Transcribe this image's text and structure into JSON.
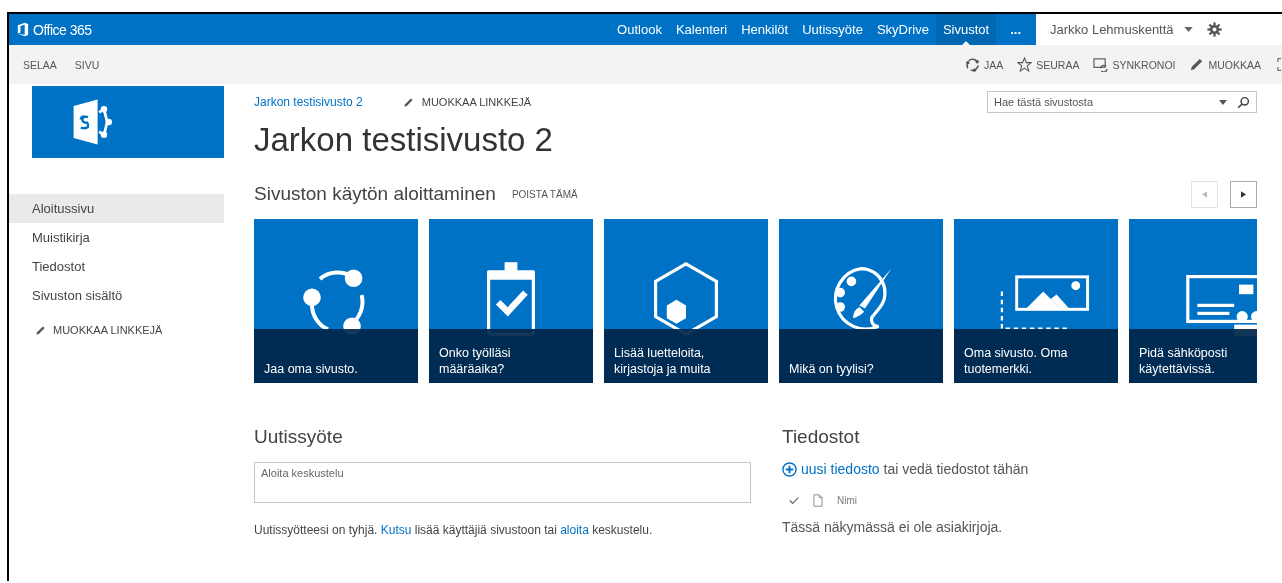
{
  "suite_bar": {
    "brand": "Office 365",
    "nav": [
      {
        "label": "Outlook",
        "selected": false
      },
      {
        "label": "Kalenteri",
        "selected": false
      },
      {
        "label": "Henkilöt",
        "selected": false
      },
      {
        "label": "Uutissyöte",
        "selected": false
      },
      {
        "label": "SkyDrive",
        "selected": false
      },
      {
        "label": "Sivustot",
        "selected": true
      },
      {
        "label": "...",
        "selected": false
      }
    ],
    "user": "Jarkko Lehmuskenttä"
  },
  "ribbon": {
    "tabs": [
      "SELAA",
      "SIVU"
    ],
    "actions": [
      {
        "label": "JAA",
        "kind": "share"
      },
      {
        "label": "SEURAA",
        "kind": "follow"
      },
      {
        "label": "SYNKRONOI",
        "kind": "sync"
      },
      {
        "label": "MUOKKAA",
        "kind": "edit"
      }
    ]
  },
  "site": {
    "breadcrumb": "Jarkon testisivusto 2",
    "edit_links": "MUOKKAA LINKKEJÄ",
    "title": "Jarkon testisivusto 2",
    "search_placeholder": "Hae tästä sivustosta"
  },
  "quick_launch": {
    "items": [
      {
        "label": "Aloitussivu",
        "selected": true
      },
      {
        "label": "Muistikirja",
        "selected": false
      },
      {
        "label": "Tiedostot",
        "selected": false
      },
      {
        "label": "Sivuston sisältö",
        "selected": false
      }
    ],
    "edit_links": "MUOKKAA LINKKEJÄ"
  },
  "getting_started": {
    "title": "Sivuston käytön aloittaminen",
    "dismiss": "POISTA TÄMÄ",
    "pager": [
      {
        "kind": "prev",
        "disabled": true
      },
      {
        "kind": "next",
        "disabled": false
      }
    ],
    "tiles": [
      {
        "kind": "share",
        "caption": [
          "Jaa oma sivusto."
        ]
      },
      {
        "kind": "task",
        "caption": [
          "Onko työlläsi",
          "määräaika?"
        ]
      },
      {
        "kind": "apps",
        "caption": [
          "Lisää luetteloita,",
          "kirjastoja ja muita"
        ]
      },
      {
        "kind": "style",
        "caption": [
          "Mikä on tyylisi?"
        ]
      },
      {
        "kind": "brand",
        "caption": [
          "Oma sivusto. Oma",
          "tuotemerkki."
        ]
      },
      {
        "kind": "mail",
        "caption": [
          "Pidä sähköposti",
          "käytettävissä."
        ]
      }
    ]
  },
  "newsfeed": {
    "title": "Uutissyöte",
    "placeholder": "Aloita keskustelu",
    "message": [
      {
        "kind": "text",
        "text": "Uutissyötteesi on tyhjä. "
      },
      {
        "kind": "link",
        "text": "Kutsu"
      },
      {
        "kind": "text",
        "text": " lisää käyttäjiä sivustoon tai "
      },
      {
        "kind": "link",
        "text": "aloita"
      },
      {
        "kind": "text",
        "text": " keskustelu."
      }
    ]
  },
  "documents": {
    "title": "Tiedostot",
    "upload": [
      {
        "kind": "link",
        "text": "uusi tiedosto"
      },
      {
        "kind": "text",
        "text": " tai vedä tiedostot tähän"
      }
    ],
    "column": "Nimi",
    "empty": "Tässä näkymässä ei ole asiakirjoja."
  }
}
